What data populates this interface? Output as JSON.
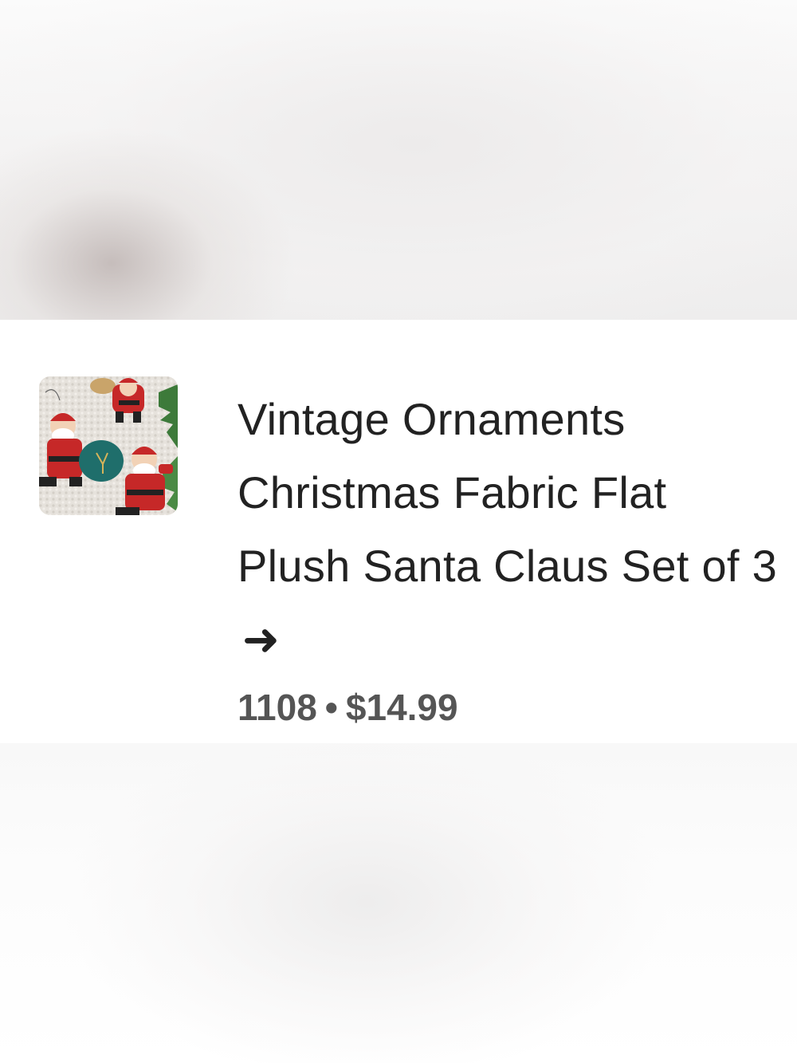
{
  "listing": {
    "title": "Vintage Ornaments Christmas Fabric Flat Plush Santa Claus Set of 3",
    "arrow": "➜",
    "count": "1108",
    "separator": "•",
    "price": "$14.99"
  },
  "thumbnail": {
    "icon": "santa-ornaments-photo"
  },
  "colors": {
    "title": "#222222",
    "meta": "#555555",
    "background": "#ffffff"
  }
}
